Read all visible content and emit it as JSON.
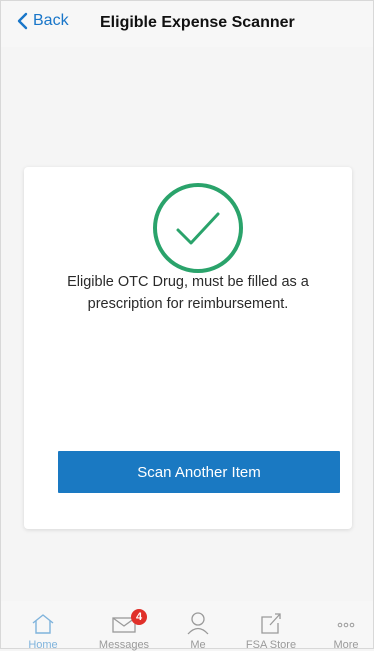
{
  "header": {
    "back_label": "Back",
    "title": "Eligible Expense Scanner"
  },
  "result": {
    "status_icon": "check-circle-icon",
    "message": "Eligible OTC Drug, must be filled as a prescription for reimbursement.",
    "accent_color": "#2aa36b"
  },
  "actions": {
    "scan_another_label": "Scan Another Item",
    "button_color": "#1a79c2"
  },
  "tabbar": {
    "tabs": [
      {
        "label": "Home",
        "icon": "home-icon",
        "active": true
      },
      {
        "label": "Messages",
        "icon": "mail-icon",
        "badge": "4"
      },
      {
        "label": "Me",
        "icon": "person-icon"
      },
      {
        "label": "FSA Store",
        "icon": "external-link-icon"
      },
      {
        "label": "More",
        "icon": "more-icon"
      }
    ]
  }
}
